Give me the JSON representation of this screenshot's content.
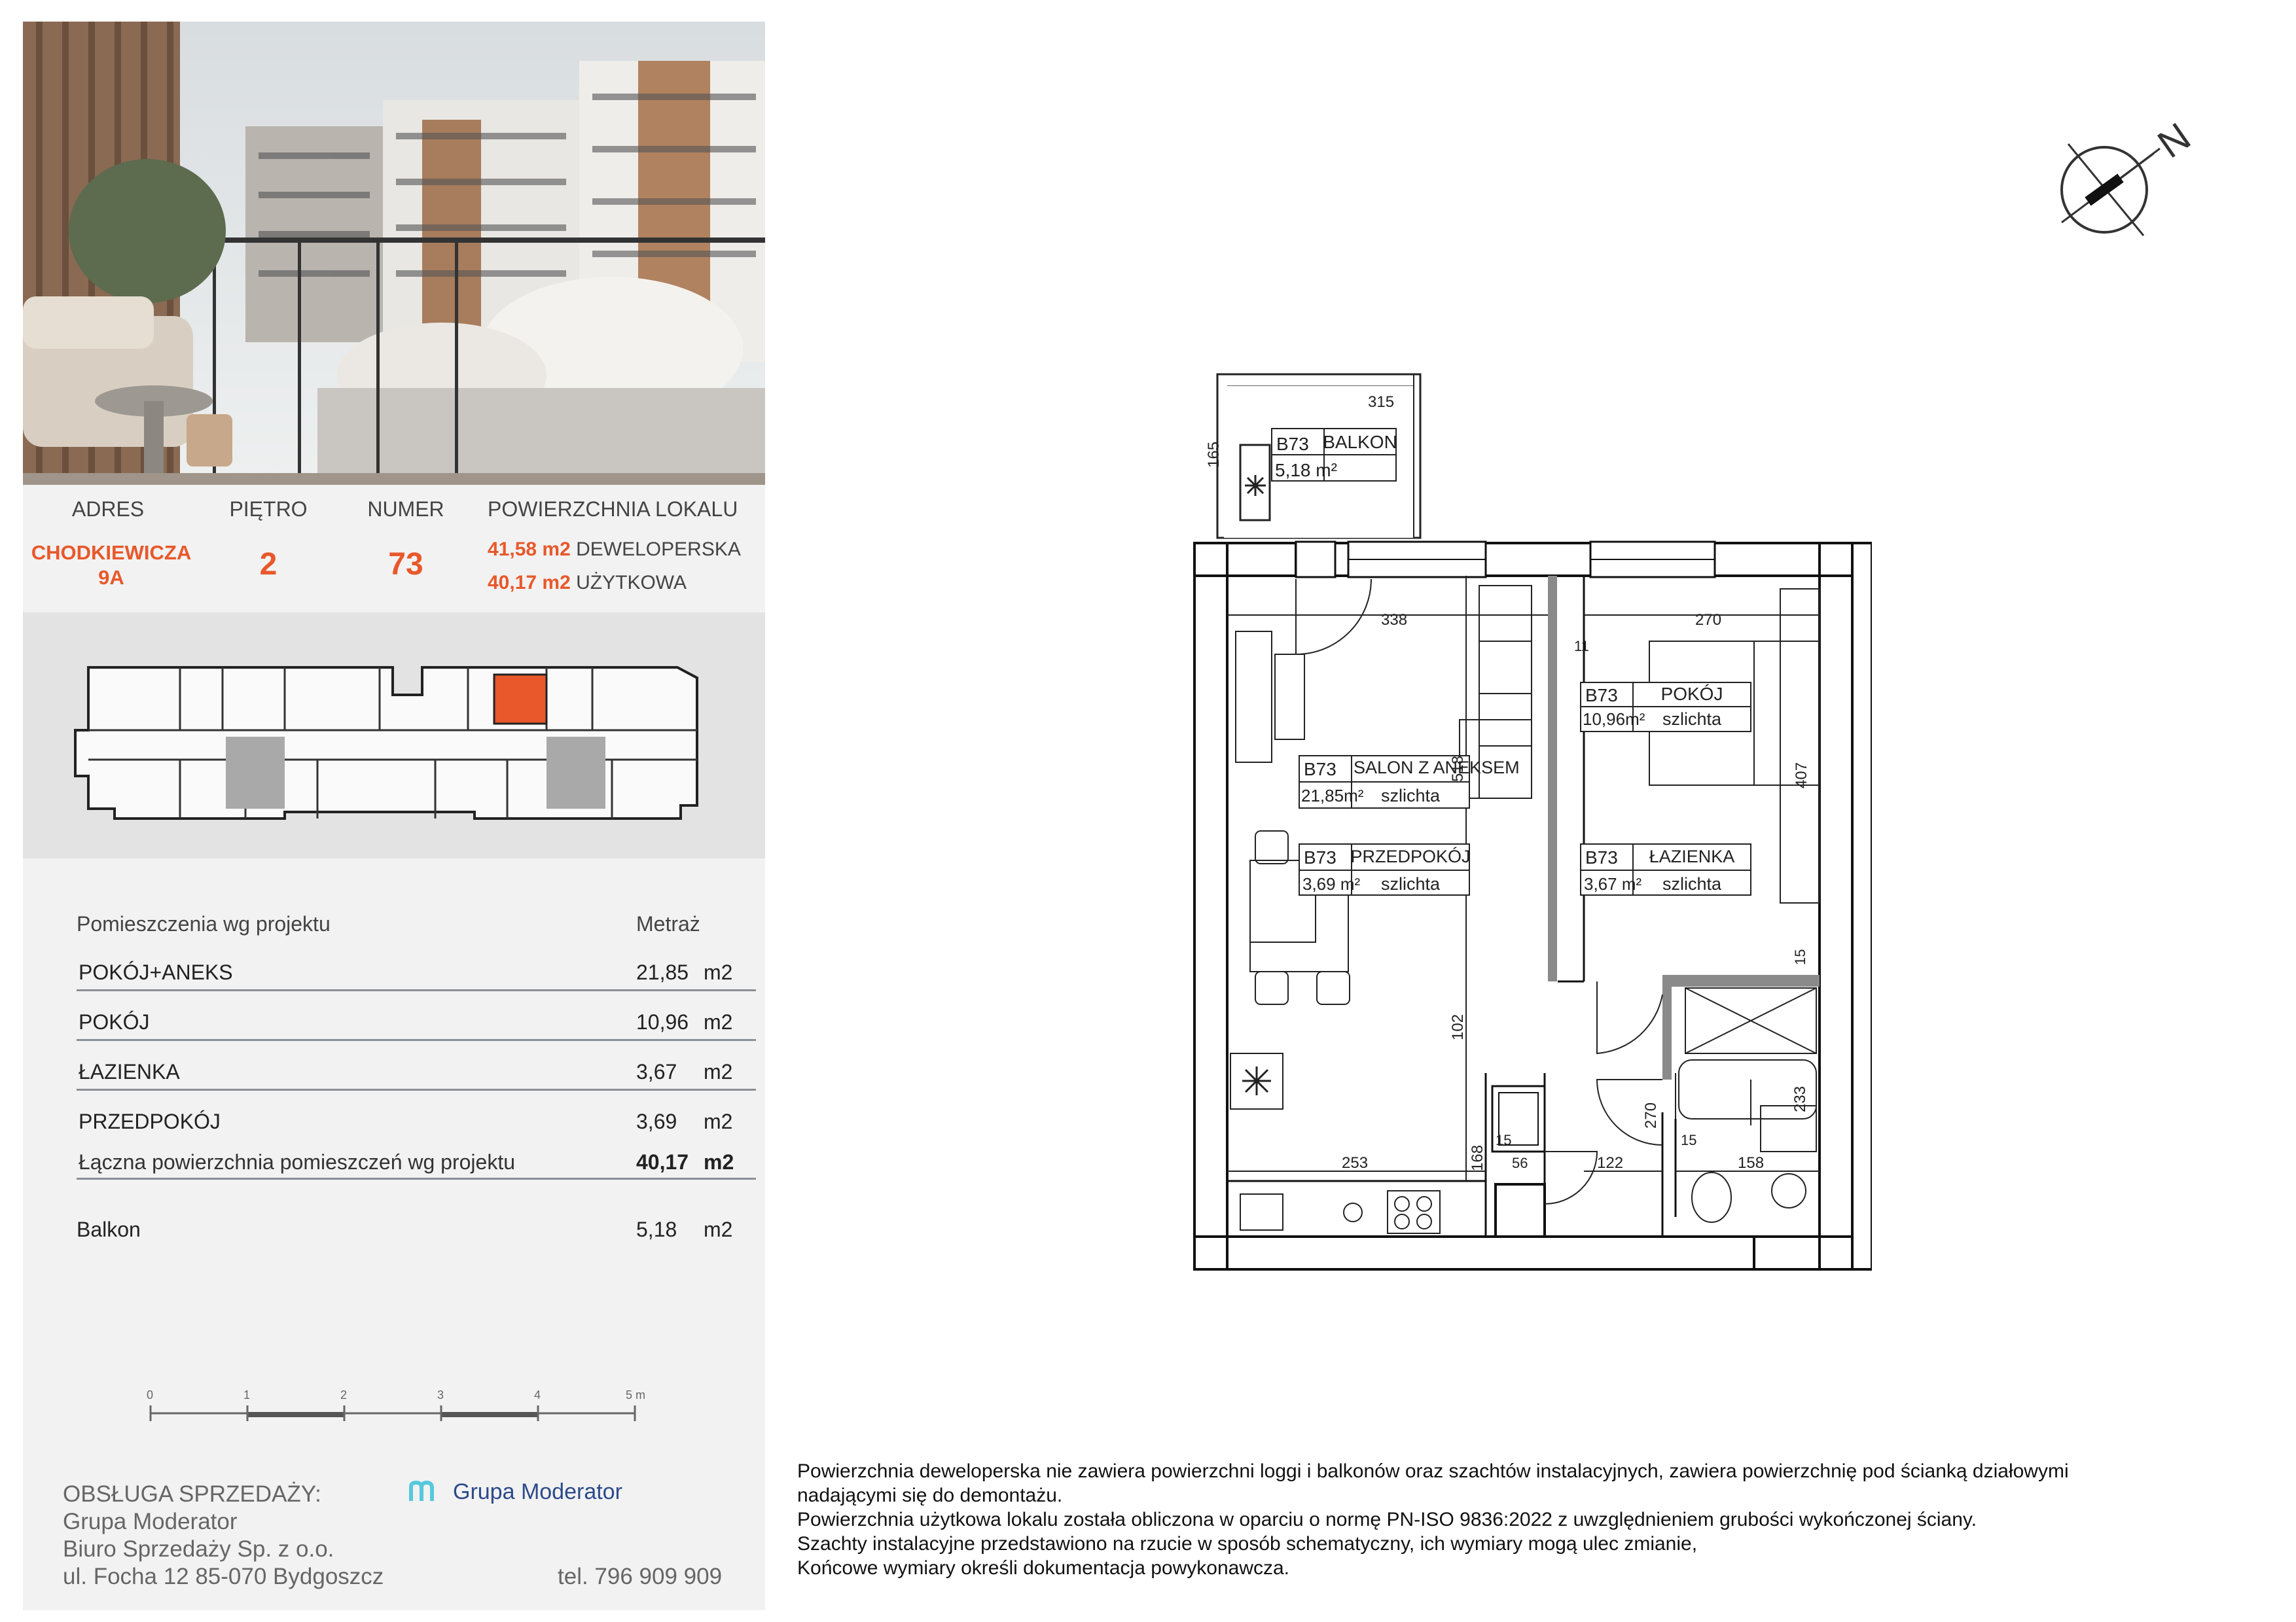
{
  "info": {
    "headers": {
      "address": "ADRES",
      "floor": "PIĘTRO",
      "number": "NUMER",
      "area": "POWIERZCHNIA LOKALU"
    },
    "address_line1": "CHODKIEWICZA",
    "address_line2": "9A",
    "floor": "2",
    "number": "73",
    "area_dev_value": "41,58 m2",
    "area_dev_label": "DEWELOPERSKA",
    "area_use_value": "40,17 m2",
    "area_use_label": "UŻYTKOWA"
  },
  "rooms_table": {
    "header_name": "Pomieszczenia wg projektu",
    "header_area": "Metraż",
    "rows": [
      {
        "name": "POKÓJ+ANEKS",
        "value": "21,85",
        "unit": "m2"
      },
      {
        "name": "POKÓJ",
        "value": "10,96",
        "unit": "m2"
      },
      {
        "name": "ŁAZIENKA",
        "value": "3,67",
        "unit": "m2"
      },
      {
        "name": "PRZEDPOKÓJ",
        "value": "3,69",
        "unit": "m2"
      }
    ],
    "total_label": "Łączna powierzchnia pomieszczeń wg projektu",
    "total_value": "40,17",
    "total_unit": "m2",
    "balcony_label": "Balkon",
    "balcony_value": "5,18",
    "balcony_unit": "m2"
  },
  "scale": {
    "ticks": [
      "0",
      "1",
      "2",
      "3",
      "4",
      "5 m"
    ]
  },
  "sales": {
    "heading": "OBSŁUGA SPRZEDAŻY:",
    "line1": "Grupa Moderator",
    "line2": "Biuro Sprzedaży Sp. z o.o.",
    "line3": "ul. Focha 12 85-070 Bydgoszcz",
    "phone": "tel. 796 909 909",
    "logo_text": "Grupa Moderator"
  },
  "compass": {
    "label": "N"
  },
  "plan": {
    "balcony": {
      "code": "B73",
      "name": "BALKON",
      "area": "5,18 m²",
      "dim_width": "315",
      "dim_depth": "165"
    },
    "salon": {
      "code": "B73",
      "name": "SALON Z ANEKSEM",
      "area": "21,85m²",
      "finish": "szlichta"
    },
    "pokoj": {
      "code": "B73",
      "name": "POKÓJ",
      "area": "10,96m²",
      "finish": "szlichta"
    },
    "przedpokoj": {
      "code": "B73",
      "name": "PRZEDPOKÓJ",
      "area": "3,69 m²",
      "finish": "szlichta"
    },
    "lazienka": {
      "code": "B73",
      "name": "ŁAZIENKA",
      "area": "3,67 m²",
      "finish": "szlichta"
    },
    "dims": {
      "d338": "338",
      "d270a": "270",
      "d11": "11",
      "d407": "407",
      "d518": "518",
      "d102": "102",
      "d253": "253",
      "d168": "168",
      "d15a": "15",
      "d56": "56",
      "d122": "122",
      "d270b": "270",
      "d15b": "15",
      "d158": "158",
      "d233": "233",
      "d15c": "15"
    }
  },
  "notes": [
    "Powierzchnia deweloperska nie zawiera powierzchni loggi i balkonów oraz szachtów instalacyjnych, zawiera powierzchnię pod ścianką działowymi",
    "nadającymi się do demontażu.",
    "Powierzchnia użytkowa lokalu została obliczona w oparciu o normę PN-ISO 9836:2022 z uwzględnieniem grubości wykończonej ściany.",
    "Szachty instalacyjne przedstawiono na rzucie w sposób schematyczny, ich wymiary mogą ulec zmianie,",
    "Końcowe wymiary określi dokumentacja powykonawcza."
  ]
}
